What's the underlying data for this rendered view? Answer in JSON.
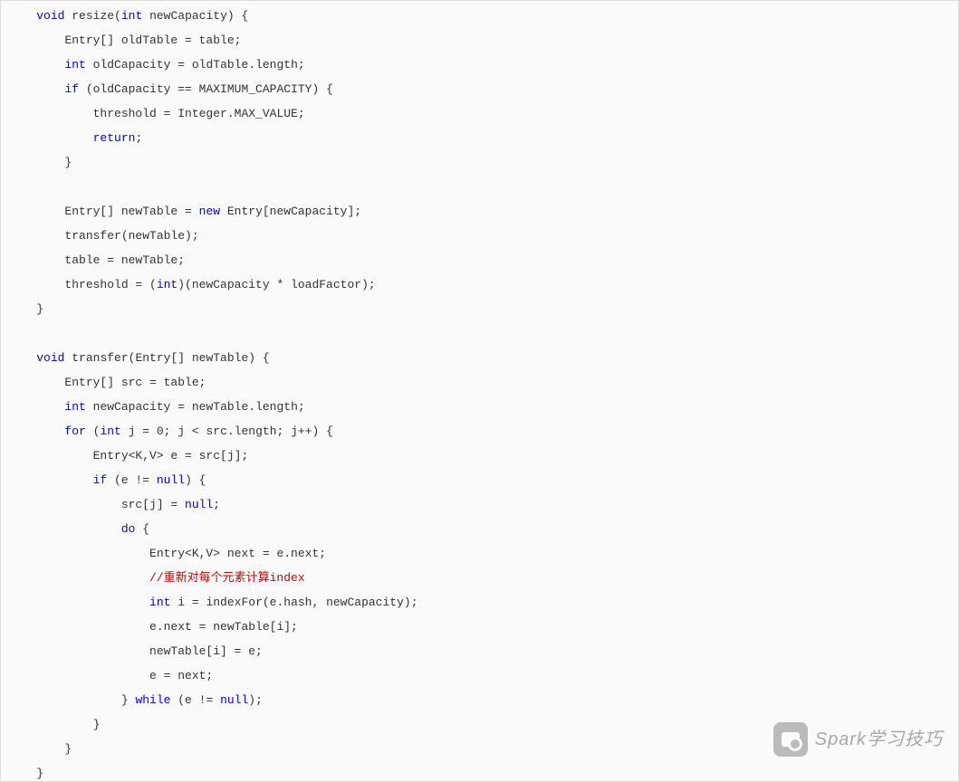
{
  "watermark": {
    "text": "Spark学习技巧"
  },
  "code": {
    "lines": [
      {
        "indent": 1,
        "tokens": [
          {
            "t": "void ",
            "c": "kw"
          },
          {
            "t": "resize(",
            "c": ""
          },
          {
            "t": "int ",
            "c": "kw"
          },
          {
            "t": "newCapacity) {",
            "c": ""
          }
        ]
      },
      {
        "indent": 2,
        "tokens": [
          {
            "t": "Entry[] oldTable = table;",
            "c": ""
          }
        ]
      },
      {
        "indent": 2,
        "tokens": [
          {
            "t": "int ",
            "c": "kw"
          },
          {
            "t": "oldCapacity = oldTable.length;",
            "c": ""
          }
        ]
      },
      {
        "indent": 2,
        "tokens": [
          {
            "t": "if ",
            "c": "kw"
          },
          {
            "t": "(oldCapacity == MAXIMUM_CAPACITY) {",
            "c": ""
          }
        ]
      },
      {
        "indent": 3,
        "tokens": [
          {
            "t": "threshold = Integer.MAX_VALUE;",
            "c": ""
          }
        ]
      },
      {
        "indent": 3,
        "tokens": [
          {
            "t": "return",
            "c": "kw"
          },
          {
            "t": ";",
            "c": ""
          }
        ]
      },
      {
        "indent": 2,
        "tokens": [
          {
            "t": "}",
            "c": ""
          }
        ]
      },
      {
        "indent": 0,
        "tokens": [
          {
            "t": "",
            "c": ""
          }
        ]
      },
      {
        "indent": 2,
        "tokens": [
          {
            "t": "Entry[] newTable = ",
            "c": ""
          },
          {
            "t": "new ",
            "c": "kw"
          },
          {
            "t": "Entry[newCapacity];",
            "c": ""
          }
        ]
      },
      {
        "indent": 2,
        "tokens": [
          {
            "t": "transfer(newTable);",
            "c": ""
          }
        ]
      },
      {
        "indent": 2,
        "tokens": [
          {
            "t": "table = newTable;",
            "c": ""
          }
        ]
      },
      {
        "indent": 2,
        "tokens": [
          {
            "t": "threshold = (",
            "c": ""
          },
          {
            "t": "int",
            "c": "kw"
          },
          {
            "t": ")(newCapacity * loadFactor);",
            "c": ""
          }
        ]
      },
      {
        "indent": 1,
        "tokens": [
          {
            "t": "}",
            "c": ""
          }
        ]
      },
      {
        "indent": 0,
        "tokens": [
          {
            "t": "",
            "c": ""
          }
        ]
      },
      {
        "indent": 1,
        "tokens": [
          {
            "t": "void ",
            "c": "kw"
          },
          {
            "t": "transfer(Entry[] newTable) {",
            "c": ""
          }
        ]
      },
      {
        "indent": 2,
        "tokens": [
          {
            "t": "Entry[] src = table;",
            "c": ""
          }
        ]
      },
      {
        "indent": 2,
        "tokens": [
          {
            "t": "int ",
            "c": "kw"
          },
          {
            "t": "newCapacity = newTable.length;",
            "c": ""
          }
        ]
      },
      {
        "indent": 2,
        "tokens": [
          {
            "t": "for ",
            "c": "kw"
          },
          {
            "t": "(",
            "c": ""
          },
          {
            "t": "int ",
            "c": "kw"
          },
          {
            "t": "j = 0; j < src.length; j++) {",
            "c": ""
          }
        ]
      },
      {
        "indent": 3,
        "tokens": [
          {
            "t": "Entry<K,V> e = src[j];",
            "c": ""
          }
        ]
      },
      {
        "indent": 3,
        "tokens": [
          {
            "t": "if ",
            "c": "kw"
          },
          {
            "t": "(e != ",
            "c": ""
          },
          {
            "t": "null",
            "c": "kw"
          },
          {
            "t": ") {",
            "c": ""
          }
        ]
      },
      {
        "indent": 4,
        "tokens": [
          {
            "t": "src[j] = ",
            "c": ""
          },
          {
            "t": "null",
            "c": "kw"
          },
          {
            "t": ";",
            "c": ""
          }
        ]
      },
      {
        "indent": 4,
        "tokens": [
          {
            "t": "do ",
            "c": "kw"
          },
          {
            "t": "{",
            "c": ""
          }
        ]
      },
      {
        "indent": 5,
        "tokens": [
          {
            "t": "Entry<K,V> next = e.next;",
            "c": ""
          }
        ]
      },
      {
        "indent": 5,
        "tokens": [
          {
            "t": "//重新对每个元素计算index",
            "c": "comment-red"
          }
        ]
      },
      {
        "indent": 5,
        "tokens": [
          {
            "t": "int ",
            "c": "kw"
          },
          {
            "t": "i = indexFor(e.hash, newCapacity);",
            "c": ""
          }
        ]
      },
      {
        "indent": 5,
        "tokens": [
          {
            "t": "e.next = newTable[i];",
            "c": ""
          }
        ]
      },
      {
        "indent": 5,
        "tokens": [
          {
            "t": "newTable[i] = e;",
            "c": ""
          }
        ]
      },
      {
        "indent": 5,
        "tokens": [
          {
            "t": "e = next;",
            "c": ""
          }
        ]
      },
      {
        "indent": 4,
        "tokens": [
          {
            "t": "} ",
            "c": ""
          },
          {
            "t": "while ",
            "c": "kw"
          },
          {
            "t": "(e != ",
            "c": ""
          },
          {
            "t": "null",
            "c": "kw"
          },
          {
            "t": ");",
            "c": ""
          }
        ]
      },
      {
        "indent": 3,
        "tokens": [
          {
            "t": "}",
            "c": ""
          }
        ]
      },
      {
        "indent": 2,
        "tokens": [
          {
            "t": "}",
            "c": ""
          }
        ]
      },
      {
        "indent": 1,
        "tokens": [
          {
            "t": "}",
            "c": ""
          }
        ]
      }
    ],
    "indentUnit": "    "
  }
}
